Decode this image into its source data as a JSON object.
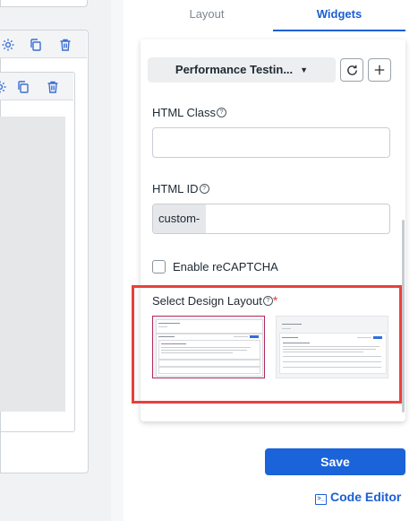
{
  "tabs": {
    "layout": "Layout",
    "widgets": "Widgets"
  },
  "widget_select": {
    "selected": "Performance Testin..."
  },
  "icons": {
    "settings": "gear-icon",
    "duplicate": "copy-icon",
    "delete": "trash-icon",
    "refresh": "refresh-icon",
    "add": "plus-icon",
    "code": "terminal-icon"
  },
  "fields": {
    "html_class": {
      "label": "HTML Class",
      "value": ""
    },
    "html_id": {
      "label": "HTML ID",
      "prefix": "custom-",
      "value": ""
    },
    "recaptcha": {
      "label": "Enable reCAPTCHA",
      "checked": false
    },
    "design_layout": {
      "label": "Select Design Layout",
      "required_mark": "*",
      "options": [
        "layout-1",
        "layout-2"
      ],
      "selected_index": 0
    }
  },
  "actions": {
    "save": "Save",
    "code_editor": "Code Editor"
  },
  "colors": {
    "accent": "#1b63d9",
    "highlight_border": "#e8413c",
    "selected_thumb": "#b3295d"
  }
}
